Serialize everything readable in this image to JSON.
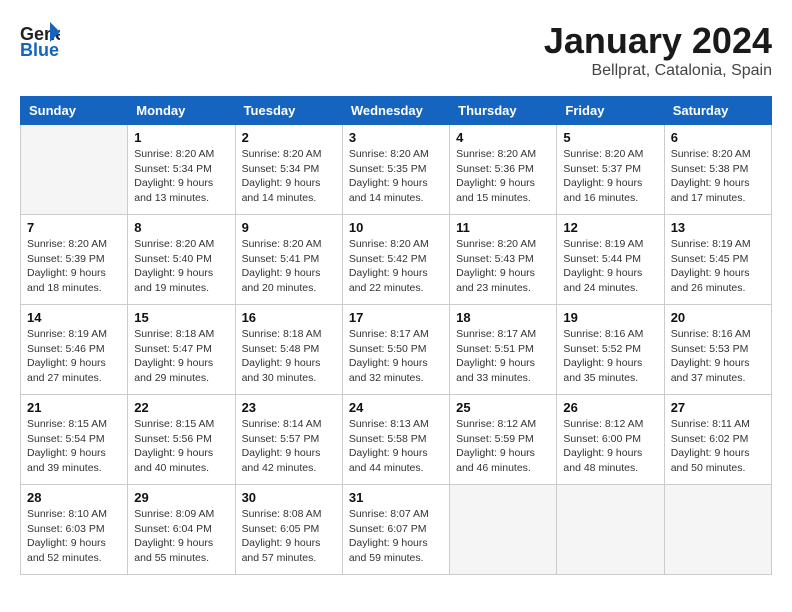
{
  "header": {
    "logo_line1": "General",
    "logo_line2": "Blue",
    "month": "January 2024",
    "location": "Bellprat, Catalonia, Spain"
  },
  "days_of_week": [
    "Sunday",
    "Monday",
    "Tuesday",
    "Wednesday",
    "Thursday",
    "Friday",
    "Saturday"
  ],
  "weeks": [
    [
      {
        "day": "",
        "info": ""
      },
      {
        "day": "1",
        "info": "Sunrise: 8:20 AM\nSunset: 5:34 PM\nDaylight: 9 hours\nand 13 minutes."
      },
      {
        "day": "2",
        "info": "Sunrise: 8:20 AM\nSunset: 5:34 PM\nDaylight: 9 hours\nand 14 minutes."
      },
      {
        "day": "3",
        "info": "Sunrise: 8:20 AM\nSunset: 5:35 PM\nDaylight: 9 hours\nand 14 minutes."
      },
      {
        "day": "4",
        "info": "Sunrise: 8:20 AM\nSunset: 5:36 PM\nDaylight: 9 hours\nand 15 minutes."
      },
      {
        "day": "5",
        "info": "Sunrise: 8:20 AM\nSunset: 5:37 PM\nDaylight: 9 hours\nand 16 minutes."
      },
      {
        "day": "6",
        "info": "Sunrise: 8:20 AM\nSunset: 5:38 PM\nDaylight: 9 hours\nand 17 minutes."
      }
    ],
    [
      {
        "day": "7",
        "info": "Sunrise: 8:20 AM\nSunset: 5:39 PM\nDaylight: 9 hours\nand 18 minutes."
      },
      {
        "day": "8",
        "info": "Sunrise: 8:20 AM\nSunset: 5:40 PM\nDaylight: 9 hours\nand 19 minutes."
      },
      {
        "day": "9",
        "info": "Sunrise: 8:20 AM\nSunset: 5:41 PM\nDaylight: 9 hours\nand 20 minutes."
      },
      {
        "day": "10",
        "info": "Sunrise: 8:20 AM\nSunset: 5:42 PM\nDaylight: 9 hours\nand 22 minutes."
      },
      {
        "day": "11",
        "info": "Sunrise: 8:20 AM\nSunset: 5:43 PM\nDaylight: 9 hours\nand 23 minutes."
      },
      {
        "day": "12",
        "info": "Sunrise: 8:19 AM\nSunset: 5:44 PM\nDaylight: 9 hours\nand 24 minutes."
      },
      {
        "day": "13",
        "info": "Sunrise: 8:19 AM\nSunset: 5:45 PM\nDaylight: 9 hours\nand 26 minutes."
      }
    ],
    [
      {
        "day": "14",
        "info": "Sunrise: 8:19 AM\nSunset: 5:46 PM\nDaylight: 9 hours\nand 27 minutes."
      },
      {
        "day": "15",
        "info": "Sunrise: 8:18 AM\nSunset: 5:47 PM\nDaylight: 9 hours\nand 29 minutes."
      },
      {
        "day": "16",
        "info": "Sunrise: 8:18 AM\nSunset: 5:48 PM\nDaylight: 9 hours\nand 30 minutes."
      },
      {
        "day": "17",
        "info": "Sunrise: 8:17 AM\nSunset: 5:50 PM\nDaylight: 9 hours\nand 32 minutes."
      },
      {
        "day": "18",
        "info": "Sunrise: 8:17 AM\nSunset: 5:51 PM\nDaylight: 9 hours\nand 33 minutes."
      },
      {
        "day": "19",
        "info": "Sunrise: 8:16 AM\nSunset: 5:52 PM\nDaylight: 9 hours\nand 35 minutes."
      },
      {
        "day": "20",
        "info": "Sunrise: 8:16 AM\nSunset: 5:53 PM\nDaylight: 9 hours\nand 37 minutes."
      }
    ],
    [
      {
        "day": "21",
        "info": "Sunrise: 8:15 AM\nSunset: 5:54 PM\nDaylight: 9 hours\nand 39 minutes."
      },
      {
        "day": "22",
        "info": "Sunrise: 8:15 AM\nSunset: 5:56 PM\nDaylight: 9 hours\nand 40 minutes."
      },
      {
        "day": "23",
        "info": "Sunrise: 8:14 AM\nSunset: 5:57 PM\nDaylight: 9 hours\nand 42 minutes."
      },
      {
        "day": "24",
        "info": "Sunrise: 8:13 AM\nSunset: 5:58 PM\nDaylight: 9 hours\nand 44 minutes."
      },
      {
        "day": "25",
        "info": "Sunrise: 8:12 AM\nSunset: 5:59 PM\nDaylight: 9 hours\nand 46 minutes."
      },
      {
        "day": "26",
        "info": "Sunrise: 8:12 AM\nSunset: 6:00 PM\nDaylight: 9 hours\nand 48 minutes."
      },
      {
        "day": "27",
        "info": "Sunrise: 8:11 AM\nSunset: 6:02 PM\nDaylight: 9 hours\nand 50 minutes."
      }
    ],
    [
      {
        "day": "28",
        "info": "Sunrise: 8:10 AM\nSunset: 6:03 PM\nDaylight: 9 hours\nand 52 minutes."
      },
      {
        "day": "29",
        "info": "Sunrise: 8:09 AM\nSunset: 6:04 PM\nDaylight: 9 hours\nand 55 minutes."
      },
      {
        "day": "30",
        "info": "Sunrise: 8:08 AM\nSunset: 6:05 PM\nDaylight: 9 hours\nand 57 minutes."
      },
      {
        "day": "31",
        "info": "Sunrise: 8:07 AM\nSunset: 6:07 PM\nDaylight: 9 hours\nand 59 minutes."
      },
      {
        "day": "",
        "info": ""
      },
      {
        "day": "",
        "info": ""
      },
      {
        "day": "",
        "info": ""
      }
    ]
  ]
}
